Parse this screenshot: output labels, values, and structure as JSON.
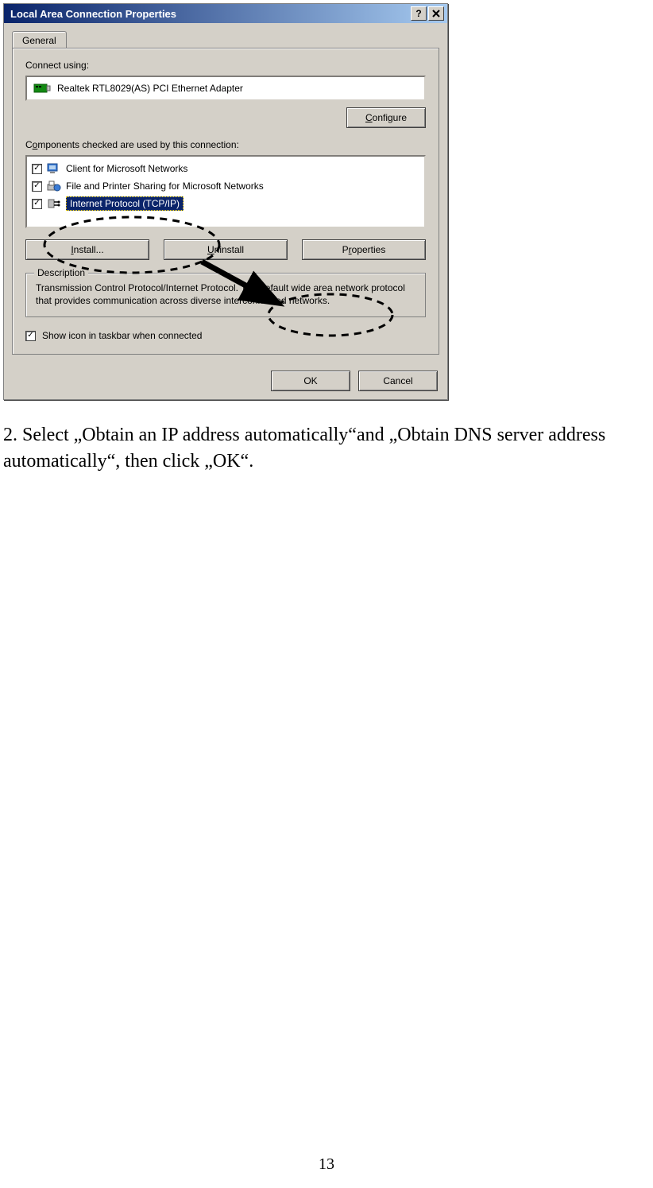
{
  "dialog": {
    "title": "Local Area Connection Properties",
    "tab_general": "General",
    "connect_using_label": "Connect using:",
    "adapter_name": "Realtek RTL8029(AS) PCI Ethernet Adapter",
    "configure_btn": "Configure",
    "configure_u": "C",
    "components_label": "Components checked are used by this connection:",
    "components": [
      {
        "label": "Client for Microsoft Networks",
        "checked": true,
        "selected": false
      },
      {
        "label": "File and Printer Sharing for Microsoft Networks",
        "checked": true,
        "selected": false
      },
      {
        "label": "Internet Protocol (TCP/IP)",
        "checked": true,
        "selected": true
      }
    ],
    "install_btn": "nstall...",
    "install_u": "I",
    "uninstall_btn": "ninstall",
    "uninstall_u": "U",
    "properties_btn": "Properties",
    "properties_u": "r",
    "description_legend": "Description",
    "description_text": "Transmission Control Protocol/Internet Protocol. The default wide area network protocol that provides communication across diverse interconnected networks.",
    "show_icon_label_pre": "Sho",
    "show_icon_u": "w",
    "show_icon_label_post": " icon in taskbar when connected",
    "show_icon_checked": true,
    "ok_btn": "OK",
    "cancel_btn": "Cancel"
  },
  "instruction": "2. Select „Obtain an IP address automatically“and „Obtain DNS server address automatically“, then click „OK“.",
  "page_number": "13"
}
